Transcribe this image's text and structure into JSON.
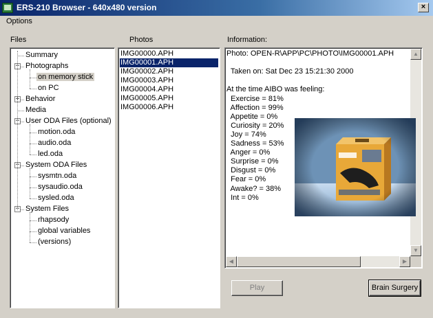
{
  "window": {
    "title": "ERS-210 Browser - 640x480 version"
  },
  "menu": {
    "options": "Options"
  },
  "files": {
    "heading": "Files",
    "tree": [
      {
        "label": "Summary",
        "level": 1,
        "expander": ""
      },
      {
        "label": "Photographs",
        "level": 1,
        "expander": "-"
      },
      {
        "label": "on memory stick",
        "level": 2,
        "expander": "",
        "selected": true
      },
      {
        "label": "on PC",
        "level": 2,
        "expander": ""
      },
      {
        "label": "Behavior",
        "level": 1,
        "expander": "+"
      },
      {
        "label": "Media",
        "level": 1,
        "expander": ""
      },
      {
        "label": "User ODA Files (optional)",
        "level": 1,
        "expander": "-"
      },
      {
        "label": "motion.oda",
        "level": 2,
        "expander": ""
      },
      {
        "label": "audio.oda",
        "level": 2,
        "expander": ""
      },
      {
        "label": "led.oda",
        "level": 2,
        "expander": ""
      },
      {
        "label": "System ODA Files",
        "level": 1,
        "expander": "-"
      },
      {
        "label": "sysmtn.oda",
        "level": 2,
        "expander": ""
      },
      {
        "label": "sysaudio.oda",
        "level": 2,
        "expander": ""
      },
      {
        "label": "sysled.oda",
        "level": 2,
        "expander": ""
      },
      {
        "label": "System Files",
        "level": 1,
        "expander": "-"
      },
      {
        "label": "rhapsody",
        "level": 2,
        "expander": ""
      },
      {
        "label": "global variables",
        "level": 2,
        "expander": ""
      },
      {
        "label": "(versions)",
        "level": 2,
        "expander": ""
      }
    ]
  },
  "photos": {
    "heading": "Photos",
    "items": [
      "IMG00000.APH",
      "IMG00001.APH",
      "IMG00002.APH",
      "IMG00003.APH",
      "IMG00004.APH",
      "IMG00005.APH",
      "IMG00006.APH"
    ],
    "selected_index": 1
  },
  "information": {
    "heading": "Information:",
    "lines": [
      "Photo: OPEN-R\\APP\\PC\\PHOTO\\IMG00001.APH",
      "",
      "  Taken on: Sat Dec 23 15:21:30 2000",
      "",
      "At the time AIBO was feeling:",
      "  Exercise = 81%",
      "  Affection = 99%",
      "  Appetite = 0%",
      "  Curiosity = 20%",
      "  Joy = 74%",
      "  Sadness = 53%",
      "  Anger = 0%",
      "  Surprise = 0%",
      "  Disgust = 0%",
      "  Fear = 0%",
      "  Awake? = 38%",
      "  Int = 0%"
    ]
  },
  "buttons": {
    "play": "Play",
    "brain_surgery": "Brain Surgery"
  },
  "icons": {
    "app": "aibo-app-icon",
    "close": "close-icon",
    "up": "scroll-up-icon",
    "down": "scroll-down-icon",
    "left": "scroll-left-icon",
    "right": "scroll-right-icon"
  }
}
